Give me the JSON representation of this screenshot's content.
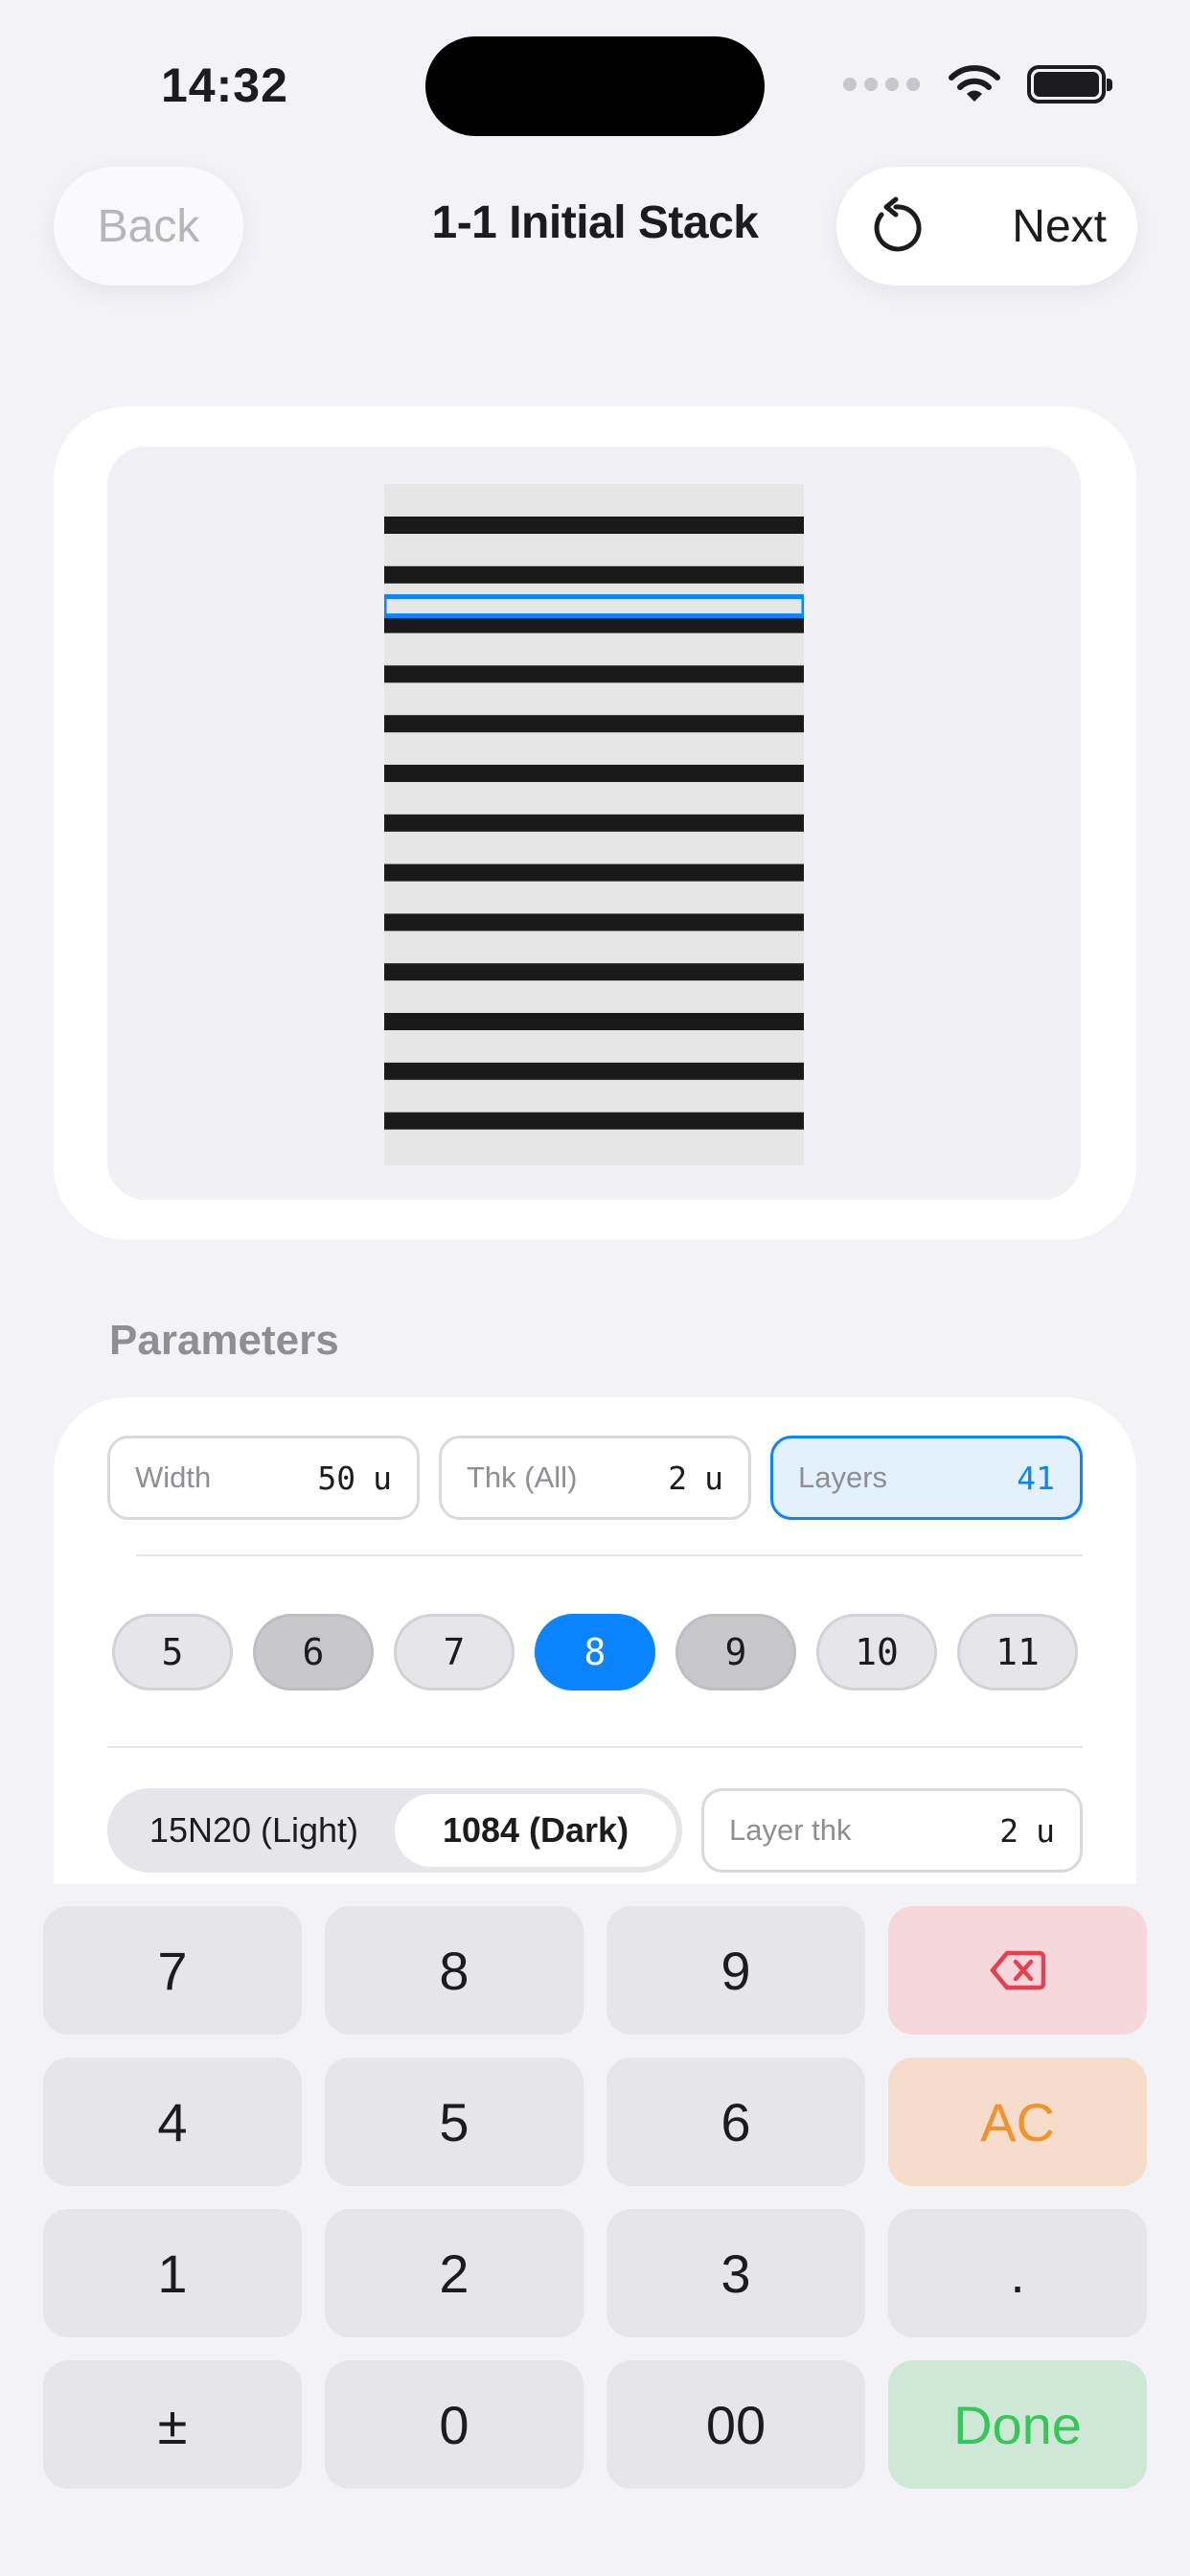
{
  "status_bar": {
    "time": "14:32"
  },
  "nav": {
    "back_label": "Back",
    "title": "1-1 Initial Stack",
    "reset_icon": "counterclockwise-arrow-icon",
    "next_label": "Next"
  },
  "preview": {
    "dark_layer_count": 13,
    "selected_layer_index": 2,
    "colors": {
      "light_layer": "#E6E6E6",
      "dark_layer": "#1A1A1A",
      "selection": "#0A84FF"
    }
  },
  "parameters": {
    "section_label": "Parameters",
    "width": {
      "label": "Width",
      "value": "50",
      "unit": "u"
    },
    "thickness_all": {
      "label": "Thk (All)",
      "value": "2",
      "unit": "u"
    },
    "layers": {
      "label": "Layers",
      "value": "41"
    },
    "layer_chips": [
      "5",
      "6",
      "7",
      "8",
      "9",
      "10",
      "11"
    ],
    "selected_chip": "8",
    "materials": [
      "15N20 (Light)",
      "1084 (Dark)"
    ],
    "selected_material": "1084 (Dark)",
    "layer_thk": {
      "label": "Layer thk",
      "value": "2",
      "unit": "u"
    }
  },
  "keypad": {
    "rows": [
      [
        "7",
        "8",
        "9",
        "backspace"
      ],
      [
        "4",
        "5",
        "6",
        "AC"
      ],
      [
        "1",
        "2",
        "3",
        "."
      ],
      [
        "±",
        "0",
        "00",
        "Done"
      ]
    ],
    "icons": {
      "backspace": "backspace-icon"
    },
    "colors": {
      "key": "#E5E5EA",
      "delete": "#F5D7DC",
      "delete_icon": "#E5404F",
      "clear": "#F6DDCB",
      "clear_text": "#F0932D",
      "done": "#CFE8D6",
      "done_text": "#34C759"
    }
  },
  "colors": {
    "background": "#F2F2F7",
    "accent": "#0A84FF"
  }
}
